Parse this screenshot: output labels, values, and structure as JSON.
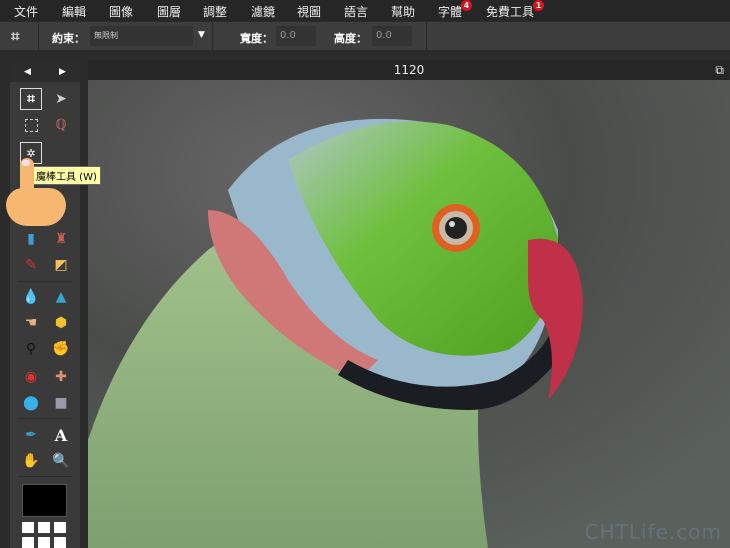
{
  "menu": [
    {
      "label": "文件"
    },
    {
      "label": "編輯"
    },
    {
      "label": "圖像"
    },
    {
      "label": "圖層"
    },
    {
      "label": "調整"
    },
    {
      "label": "濾鏡"
    },
    {
      "label": "視圖"
    },
    {
      "label": "語言"
    },
    {
      "label": "幫助"
    },
    {
      "label": "字體",
      "badge": "4"
    },
    {
      "label": "免費工具",
      "badge": "1"
    }
  ],
  "options": {
    "constraint_label": "約束：",
    "constraint_value": "無限制",
    "width_label": "寬度：",
    "width_value": "0.0",
    "height_label": "高度：",
    "height_value": "0.0"
  },
  "canvas": {
    "title": "1120",
    "watermark": "CHTLife.com"
  },
  "tooltip": "魔棒工具 (W)",
  "toolbox": {
    "prev": "◀",
    "next": "▶",
    "color": "#000000"
  }
}
